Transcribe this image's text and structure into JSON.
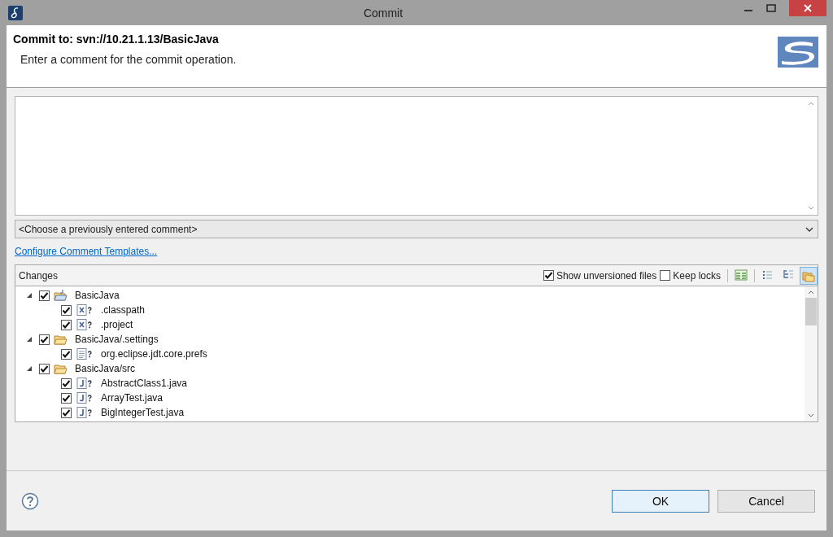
{
  "window": {
    "title": "Commit"
  },
  "header": {
    "title": "Commit to: svn://10.21.1.13/BasicJava",
    "message": "Enter a comment for the commit operation."
  },
  "previous_comment": {
    "value": "<Choose a previously entered comment>"
  },
  "templates_link": "Configure Comment Templates...",
  "changes": {
    "title": "Changes",
    "options": [
      {
        "label": "Show unversioned files",
        "checked": true
      },
      {
        "label": "Keep locks",
        "checked": false
      }
    ],
    "toolbar": [
      {
        "kind": "table",
        "selected": false
      },
      {
        "kind": "flat",
        "selected": false
      },
      {
        "kind": "tree",
        "selected": false
      },
      {
        "kind": "folders",
        "selected": true
      }
    ],
    "tree": [
      {
        "label": "BasicJava",
        "kind": "project",
        "checked": true,
        "expanded": true,
        "children": [
          {
            "label": ".classpath",
            "kind": "xml",
            "checked": true,
            "unversioned": true
          },
          {
            "label": ".project",
            "kind": "xml",
            "checked": true,
            "unversioned": true
          }
        ]
      },
      {
        "label": "BasicJava/.settings",
        "kind": "folder",
        "checked": true,
        "expanded": true,
        "children": [
          {
            "label": "org.eclipse.jdt.core.prefs",
            "kind": "text",
            "checked": true,
            "unversioned": true
          }
        ]
      },
      {
        "label": "BasicJava/src",
        "kind": "folder",
        "checked": true,
        "expanded": true,
        "children": [
          {
            "label": "AbstractClass1.java",
            "kind": "java",
            "checked": true,
            "unversioned": true
          },
          {
            "label": "ArrayTest.java",
            "kind": "java",
            "checked": true,
            "unversioned": true
          },
          {
            "label": "BigIntegerTest.java",
            "kind": "java",
            "checked": true,
            "unversioned": true
          }
        ]
      }
    ]
  },
  "buttons": [
    {
      "label": "OK",
      "default": true
    },
    {
      "label": "Cancel",
      "default": false
    }
  ]
}
